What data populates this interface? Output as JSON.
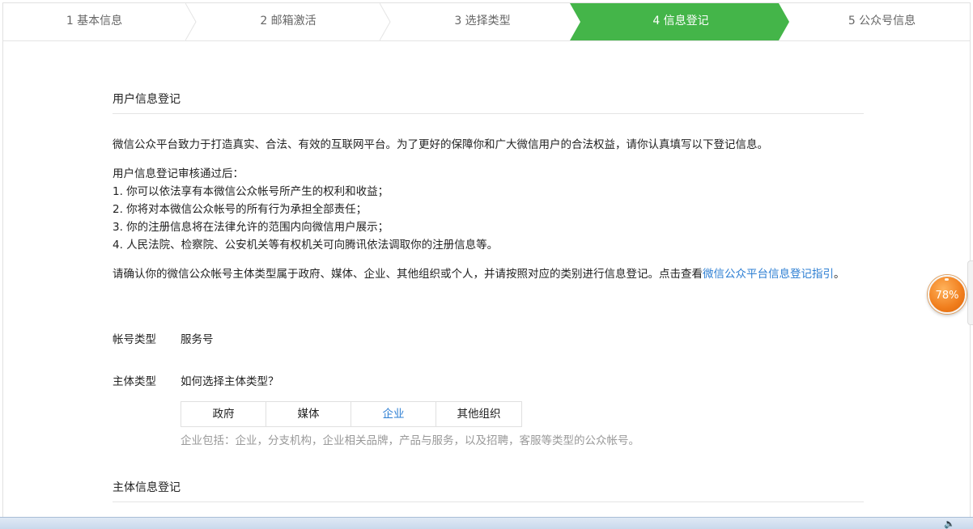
{
  "steps": [
    {
      "label": "1 基本信息"
    },
    {
      "label": "2 邮箱激活"
    },
    {
      "label": "3 选择类型"
    },
    {
      "label": "4 信息登记"
    },
    {
      "label": "5 公众号信息"
    }
  ],
  "active_step": 4,
  "colors": {
    "accent_green": "#44b549",
    "link_blue": "#2e7fd3",
    "badge_orange": "#f07d1c"
  },
  "user_section": {
    "title": "用户信息登记",
    "intro": "微信公众平台致力于打造真实、合法、有效的互联网平台。为了更好的保障你和广大微信用户的合法权益，请你认真填写以下登记信息。",
    "after_review_title": "用户信息登记审核通过后：",
    "points": [
      "1. 你可以依法享有本微信公众帐号所产生的权利和收益；",
      "2. 你将对本微信公众帐号的所有行为承担全部责任；",
      "3. 你的注册信息将在法律允许的范围内向微信用户展示；",
      "4. 人民法院、检察院、公安机关等有权机关可向腾讯依法调取你的注册信息等。"
    ],
    "confirm_text": "请确认你的微信公众帐号主体类型属于政府、媒体、企业、其他组织或个人，并请按照对应的类别进行信息登记。点击查看",
    "guide_link": "微信公众平台信息登记指引",
    "confirm_end": "。"
  },
  "account_type": {
    "label": "帐号类型",
    "value": "服务号"
  },
  "subject_type": {
    "label": "主体类型",
    "help_link": "如何选择主体类型？",
    "options": [
      "政府",
      "媒体",
      "企业",
      "其他组织"
    ],
    "selected": "企业",
    "hint": "企业包括：企业，分支机构，企业相关品牌，产品与服务，以及招聘，客服等类型的公众帐号。"
  },
  "subject_section": {
    "title": "主体信息登记"
  },
  "badge": {
    "text": "78%"
  }
}
